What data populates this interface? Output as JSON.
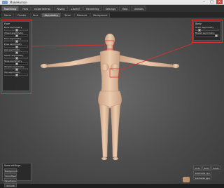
{
  "window": {
    "title": "MakeHuman"
  },
  "main_tabs": [
    "Modelling",
    "Files",
    "Experiments",
    "Posing",
    "Library",
    "Rendering",
    "Settings",
    "Help",
    "Utilities"
  ],
  "sub_tabs": [
    "Macro",
    "Gender",
    "Face",
    "Asymmetry",
    "Torso",
    "Measure",
    "Background"
  ],
  "active_main_tab": "Modelling",
  "active_sub_tab": "Asymmetry",
  "left_panel": {
    "title": "Face",
    "sliders": [
      {
        "label": "Brow asymmetry",
        "value": 0.5
      },
      {
        "label": "Cheek asymmetry",
        "value": 0.5
      },
      {
        "label": "Ears asymmetry",
        "value": 0.5
      },
      {
        "label": "Eyes asymmetry",
        "value": 0.5
      },
      {
        "label": "Jaw asymmetry",
        "value": 0.5
      },
      {
        "label": "Mouth asymmetry",
        "value": 0.5
      },
      {
        "label": "Nose asymmetry",
        "value": 0.5
      },
      {
        "label": "Temple asymmetry",
        "value": 0.5
      },
      {
        "label": "Top asymmetry",
        "value": 0.5
      }
    ]
  },
  "right_panel": {
    "title": "Body",
    "sliders": [
      {
        "label": "Trunk asymmetry",
        "value": 0.1
      },
      {
        "label": "Breast asymmetry",
        "value": 0.9
      }
    ]
  },
  "view_panel": {
    "title": "View settings",
    "buttons": [
      "Background",
      "Smoothed",
      "Wireframe",
      "Smooth"
    ]
  },
  "bottom_right": {
    "row1": [
      "Undo",
      "Redo",
      "Reset"
    ],
    "row2": [
      "Subdivide cpu",
      "Subdivide gpu"
    ]
  },
  "colors": {
    "highlight": "#e03030",
    "background": "#4c4c4c",
    "skin": "#e7c4a6"
  }
}
